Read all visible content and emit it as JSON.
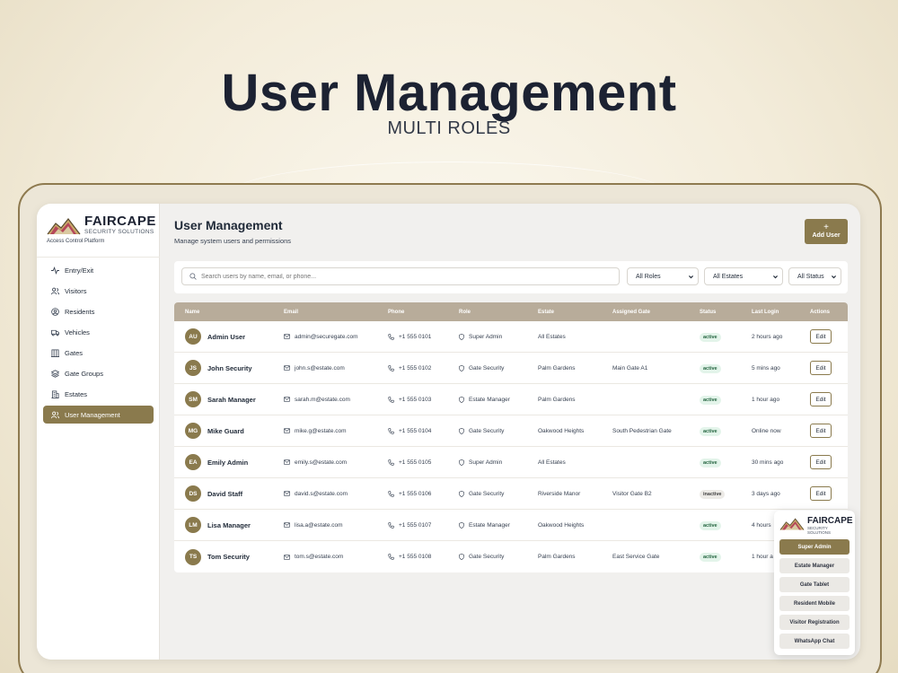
{
  "hero": {
    "title": "User Management",
    "subtitle": "MULTI ROLES"
  },
  "colors": {
    "accent": "#8a7a4d",
    "table_header": "#b8ac9a",
    "active_badge": "#e3f4ea"
  },
  "brand": {
    "name": "FAIRCAPE",
    "tagline": "SECURITY SOLUTIONS",
    "platform": "Access Control Platform"
  },
  "sidebar": {
    "items": [
      {
        "label": "Entry/Exit",
        "icon": "activity-icon"
      },
      {
        "label": "Visitors",
        "icon": "users-icon"
      },
      {
        "label": "Residents",
        "icon": "user-circle-icon"
      },
      {
        "label": "Vehicles",
        "icon": "truck-icon"
      },
      {
        "label": "Gates",
        "icon": "gate-icon"
      },
      {
        "label": "Gate Groups",
        "icon": "layers-icon"
      },
      {
        "label": "Estates",
        "icon": "building-icon"
      },
      {
        "label": "User Management",
        "icon": "user-cog-icon",
        "active": true
      }
    ]
  },
  "main": {
    "title": "User Management",
    "subtitle": "Manage system users and permissions",
    "add_plus": "+",
    "add_label": "Add User"
  },
  "filters": {
    "search_placeholder": "Search users by name, email, or phone...",
    "roles": "All Roles",
    "estates": "All Estates",
    "status": "All Status"
  },
  "table": {
    "columns": [
      "Name",
      "Email",
      "Phone",
      "Role",
      "Estate",
      "Assigned Gate",
      "Status",
      "Last Login",
      "Actions"
    ],
    "edit_label": "Edit",
    "rows": [
      {
        "initials": "AU",
        "name": "Admin User",
        "email": "admin@securegate.com",
        "phone": "+1 555 0101",
        "role": "Super Admin",
        "estate": "All Estates",
        "gate": "",
        "status": "active",
        "last_login": "2 hours ago"
      },
      {
        "initials": "JS",
        "name": "John Security",
        "email": "john.s@estate.com",
        "phone": "+1 555 0102",
        "role": "Gate Security",
        "estate": "Palm Gardens",
        "gate": "Main Gate A1",
        "status": "active",
        "last_login": "5 mins ago"
      },
      {
        "initials": "SM",
        "name": "Sarah Manager",
        "email": "sarah.m@estate.com",
        "phone": "+1 555 0103",
        "role": "Estate Manager",
        "estate": "Palm Gardens",
        "gate": "",
        "status": "active",
        "last_login": "1 hour ago"
      },
      {
        "initials": "MG",
        "name": "Mike Guard",
        "email": "mike.g@estate.com",
        "phone": "+1 555 0104",
        "role": "Gate Security",
        "estate": "Oakwood Heights",
        "gate": "South Pedestrian Gate",
        "status": "active",
        "last_login": "Online now"
      },
      {
        "initials": "EA",
        "name": "Emily Admin",
        "email": "emily.s@estate.com",
        "phone": "+1 555 0105",
        "role": "Super Admin",
        "estate": "All Estates",
        "gate": "",
        "status": "active",
        "last_login": "30 mins ago"
      },
      {
        "initials": "DS",
        "name": "David Staff",
        "email": "david.s@estate.com",
        "phone": "+1 555 0106",
        "role": "Gate Security",
        "estate": "Riverside Manor",
        "gate": "Visitor Gate B2",
        "status": "inactive",
        "last_login": "3 days ago"
      },
      {
        "initials": "LM",
        "name": "Lisa Manager",
        "email": "lisa.a@estate.com",
        "phone": "+1 555 0107",
        "role": "Estate Manager",
        "estate": "Oakwood Heights",
        "gate": "",
        "status": "active",
        "last_login": "4 hours"
      },
      {
        "initials": "TS",
        "name": "Tom Security",
        "email": "tom.s@estate.com",
        "phone": "+1 555 0108",
        "role": "Gate Security",
        "estate": "Palm Gardens",
        "gate": "East Service Gate",
        "status": "active",
        "last_login": "1 hour a"
      }
    ]
  },
  "popup": {
    "brand": "FAIRCAPE",
    "tagline": "SECURITY SOLUTIONS",
    "items": [
      "Super Admin",
      "Estate Manager",
      "Gate Tablet",
      "Resident Mobile",
      "Visitor Registration",
      "WhatsApp Chat"
    ]
  }
}
